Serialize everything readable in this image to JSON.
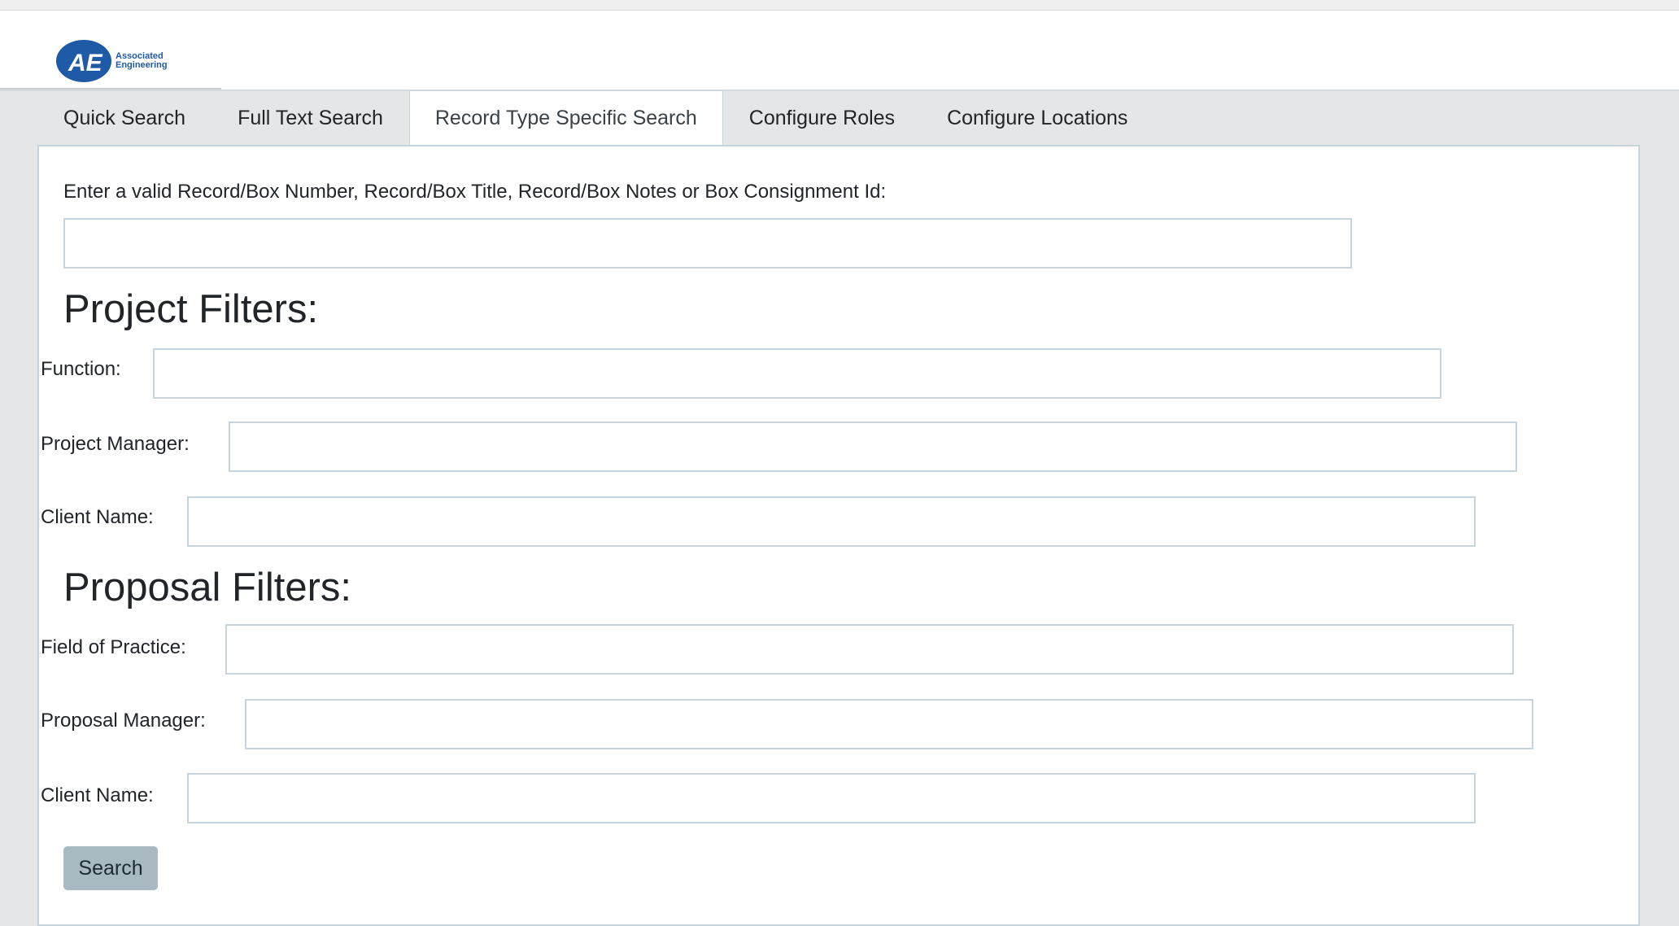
{
  "brand": {
    "logo_mark": "AE",
    "logo_line1": "Associated",
    "logo_line2": "Engineering",
    "color": "#1f5aa6"
  },
  "tabs": [
    {
      "label": "Quick Search",
      "active": false
    },
    {
      "label": "Full Text Search",
      "active": false
    },
    {
      "label": "Record Type Specific Search",
      "active": true
    },
    {
      "label": "Configure Roles",
      "active": false
    },
    {
      "label": "Configure Locations",
      "active": false
    }
  ],
  "form": {
    "intro_label": "Enter a valid Record/Box Number, Record/Box Title, Record/Box Notes or Box Consignment Id:",
    "intro_value": "",
    "project": {
      "title": "Project Filters:",
      "function_label": "Function:",
      "project_manager_label": "Project Manager:",
      "client_name_label": "Client Name:"
    },
    "proposal": {
      "title": "Proposal Filters:",
      "field_of_practice_label": "Field of Practice:",
      "proposal_manager_label": "Proposal Manager:",
      "client_name_label": "Client Name:"
    },
    "search_button": "Search"
  },
  "colors": {
    "page_background": "#e4e6e8",
    "border": "#c8d4dc",
    "button": "#a9b9c2"
  }
}
